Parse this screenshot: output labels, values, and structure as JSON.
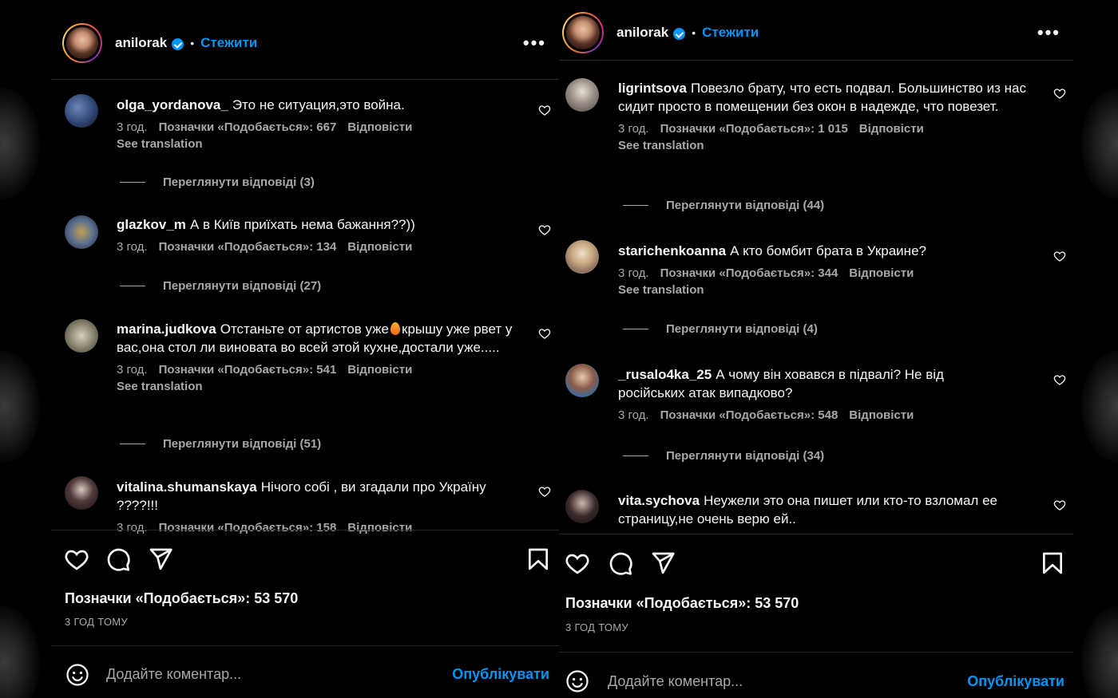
{
  "post": {
    "username": "anilorak",
    "follow_label": "Стежити",
    "dot": "•",
    "more_label": "•••",
    "likes_text": "Позначки «Подобається»: 53 570",
    "time_ago": "3 ГОД ТОМУ",
    "add_comment_placeholder": "Додайте коментар...",
    "publish_label": "Опублікувати"
  },
  "labels": {
    "likes_prefix": "Позначки «Подобається»: ",
    "reply": "Відповісти",
    "see_translation": "See translation"
  },
  "panel1": {
    "comments": [
      {
        "user": "olga_yordanova_",
        "text": "Это не ситуация,это война.",
        "time": "3 год.",
        "likes": "Позначки «Подобається»: 667",
        "reply": "Відповісти",
        "translation": "See translation",
        "replies": "Переглянути відповіді (3)"
      },
      {
        "user": "glazkov_m",
        "text": "А в Київ приїхать нема бажання??))",
        "time": "3 год.",
        "likes": "Позначки «Подобається»: 134",
        "reply": "Відповісти",
        "replies": "Переглянути відповіді (27)"
      },
      {
        "user": "marina.judkova",
        "text_before": "Отстаньте от артистов уже",
        "text_after": "крышу уже рвет у вас,она стол ли виновата во всей этой кухне,достали уже.....",
        "time": "3 год.",
        "likes": "Позначки «Подобається»: 541",
        "reply": "Відповісти",
        "translation": "See translation",
        "replies": "Переглянути відповіді (51)"
      },
      {
        "user": "vitalina.shumanskaya",
        "text": "Нічого собі , ви згадали про Україну ????!!!",
        "time": "3 год.",
        "likes": "Позначки «Подобається»: 158",
        "reply": "Відповісти"
      }
    ]
  },
  "panel2": {
    "comments": [
      {
        "user": "ligrintsova",
        "text": "Повезло брату, что есть подвал. Большинство из нас сидит просто в помещении без окон в надежде, что повезет.",
        "time": "3 год.",
        "likes": "Позначки «Подобається»: 1 015",
        "reply": "Відповісти",
        "translation": "See translation",
        "replies": "Переглянути відповіді (44)"
      },
      {
        "user": "starichenkoanna",
        "text": "А кто бомбит брата в Украине?",
        "time": "3 год.",
        "likes": "Позначки «Подобається»: 344",
        "reply": "Відповісти",
        "translation": "See translation",
        "replies": "Переглянути відповіді (4)"
      },
      {
        "user": "_rusalo4ka_25",
        "text": "А чому він ховався в підвалі? Не від російських атак випадково?",
        "time": "3 год.",
        "likes": "Позначки «Подобається»: 548",
        "reply": "Відповісти",
        "replies": "Переглянути відповіді (34)"
      },
      {
        "user": "vita.sychova",
        "text": "Неужели это она пишет или кто-то взломал ее страницу,не очень верю ей.."
      }
    ]
  },
  "colors": {
    "background": "#000000",
    "accent_blue": "#0095f6",
    "text_primary": "#f5f5f5",
    "text_secondary": "#a8a8a8",
    "divider": "#262626"
  },
  "icons": [
    "heart-icon",
    "comment-icon",
    "share-icon",
    "bookmark-icon",
    "emoji-icon",
    "verified-badge-icon",
    "more-options-icon"
  ]
}
